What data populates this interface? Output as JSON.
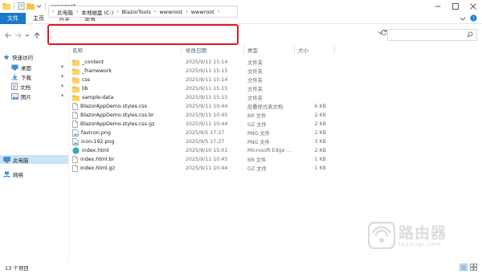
{
  "window": {
    "title": "wwwroot"
  },
  "ribbon": {
    "tabs": [
      {
        "label": "文件",
        "active": true
      },
      {
        "label": "主页"
      },
      {
        "label": "共享"
      },
      {
        "label": "查看"
      }
    ]
  },
  "address": {
    "crumbs": [
      "此电脑",
      "本地磁盘 (C:)",
      "BlazorTools",
      "wwwroot",
      "wwwroot"
    ],
    "highlight_color": "#e0191b"
  },
  "sidebar": {
    "items": [
      {
        "label": "快速访问",
        "icon": "star-icon"
      },
      {
        "label": "桌面",
        "icon": "desktop-folder-icon",
        "pinned": true
      },
      {
        "label": "下载",
        "icon": "download-folder-icon",
        "pinned": true
      },
      {
        "label": "文档",
        "icon": "documents-folder-icon",
        "pinned": true
      },
      {
        "label": "图片",
        "icon": "pictures-folder-icon",
        "pinned": true
      },
      {
        "label": "此电脑",
        "icon": "computer-icon",
        "selected": true
      },
      {
        "label": "网络",
        "icon": "network-icon"
      }
    ]
  },
  "columns": {
    "name": "名称",
    "date": "修改日期",
    "type": "类型",
    "size": "大小"
  },
  "files": [
    {
      "name": "_content",
      "date": "2025/9/11 15:14",
      "type": "文件夹",
      "size": "",
      "icon": "folder-icon"
    },
    {
      "name": "_framework",
      "date": "2025/9/11 15:15",
      "type": "文件夹",
      "size": "",
      "icon": "folder-icon"
    },
    {
      "name": "css",
      "date": "2025/9/11 15:14",
      "type": "文件夹",
      "size": "",
      "icon": "folder-icon"
    },
    {
      "name": "lib",
      "date": "2025/9/11 15:15",
      "type": "文件夹",
      "size": "",
      "icon": "folder-icon"
    },
    {
      "name": "sample-data",
      "date": "2025/9/11 15:15",
      "type": "文件夹",
      "size": "",
      "icon": "folder-icon"
    },
    {
      "name": "BlazorAppDemo.styles.css",
      "date": "2025/9/11 10:44",
      "type": "层叠样式表文档",
      "size": "6 KB",
      "icon": "file-icon"
    },
    {
      "name": "BlazorAppDemo.styles.css.br",
      "date": "2025/9/11 10:45",
      "type": "BR 文件",
      "size": "2 KB",
      "icon": "file-icon"
    },
    {
      "name": "BlazorAppDemo.styles.css.gz",
      "date": "2025/9/11 10:44",
      "type": "GZ 文件",
      "size": "2 KB",
      "icon": "file-icon"
    },
    {
      "name": "favicon.png",
      "date": "2025/9/5 17:27",
      "type": "PNG 文件",
      "size": "2 KB",
      "icon": "image-file-icon"
    },
    {
      "name": "icon-192.png",
      "date": "2025/9/5 17:27",
      "type": "PNG 文件",
      "size": "3 KB",
      "icon": "image-file-icon"
    },
    {
      "name": "index.html",
      "date": "2025/9/10 15:01",
      "type": "Microsoft Edge ...",
      "size": "2 KB",
      "icon": "edge-icon"
    },
    {
      "name": "index.html.br",
      "date": "2025/9/11 10:45",
      "type": "BR 文件",
      "size": "1 KB",
      "icon": "file-icon"
    },
    {
      "name": "index.html.gz",
      "date": "2025/9/11 10:44",
      "type": "GZ 文件",
      "size": "1 KB",
      "icon": "file-icon"
    }
  ],
  "status": {
    "item_count": "13 个项目"
  },
  "watermark": {
    "text_cn": "路由器",
    "text_en": "luyouqi.com"
  }
}
